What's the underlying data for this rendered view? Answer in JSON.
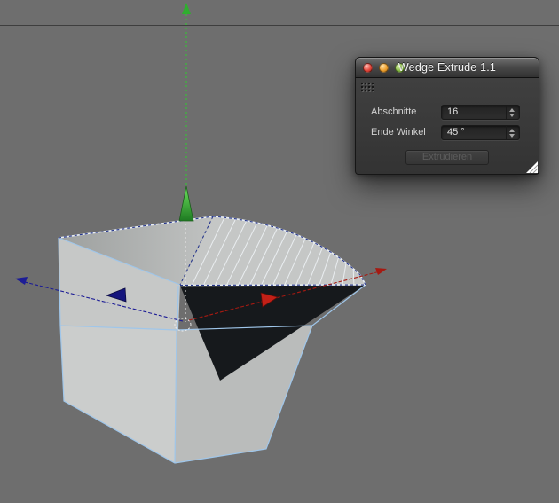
{
  "dialog": {
    "title": "Wedge Extrude 1.1",
    "fields": [
      {
        "label": "Abschnitte",
        "value": "16"
      },
      {
        "label": "Ende Winkel",
        "value": "45 °"
      }
    ],
    "button_label": "Extrudieren"
  },
  "viewport": {
    "background_color": "#6e6e6e",
    "wireframe_color": "#9fc6ea",
    "selected_edge_color": "#26368c",
    "axis_colors": {
      "x": "#a51a12",
      "y": "#2fae2f",
      "z": "#1c1c96"
    }
  }
}
